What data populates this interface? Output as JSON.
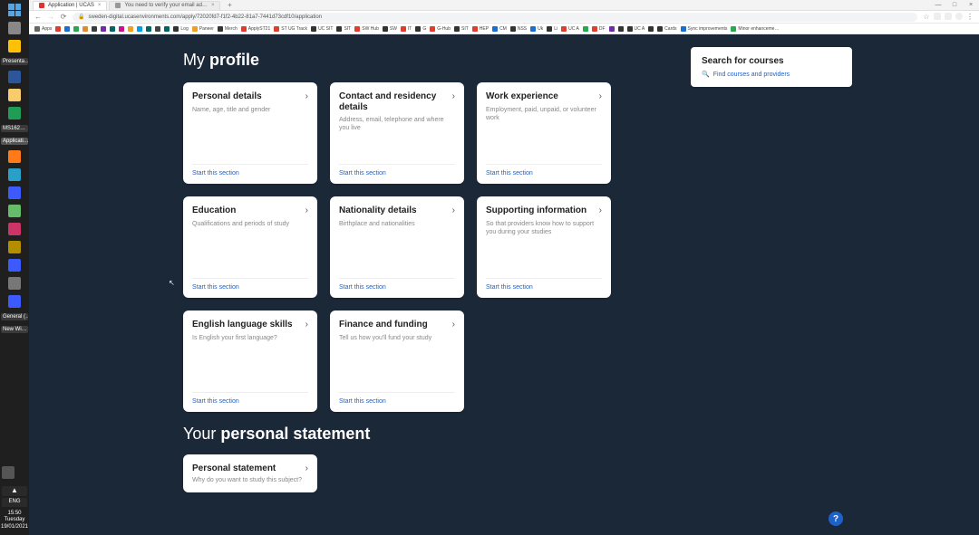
{
  "taskbar": {
    "labels": [
      "Presenta…",
      "MS162…",
      "Applicati…",
      "General (…",
      "New Wi…"
    ],
    "lang": "ENG",
    "time": "15:50",
    "day": "Tuesday",
    "date": "19/01/2021"
  },
  "tabs": {
    "active": "Application | UCAS",
    "second": "You need to verify your email ad…"
  },
  "url": "sweden-digital.ucasenvironments.com/apply/72020fd7-f1f2-4b22-81a7-7441d73cdf10/application",
  "bookmarks": [
    {
      "label": "Apps",
      "color": "#666"
    },
    {
      "label": "",
      "color": "#e03e2d"
    },
    {
      "label": "",
      "color": "#196fd0"
    },
    {
      "label": "",
      "color": "#2aa84f"
    },
    {
      "label": "",
      "color": "#e0892d"
    },
    {
      "label": "",
      "color": "#3b3b3b"
    },
    {
      "label": "",
      "color": "#6f2da8"
    },
    {
      "label": "",
      "color": "#006666"
    },
    {
      "label": "",
      "color": "#c71585"
    },
    {
      "label": "",
      "color": "#f0a020"
    },
    {
      "label": "",
      "color": "#00a0e9"
    },
    {
      "label": "",
      "color": "#006666"
    },
    {
      "label": "",
      "color": "#444"
    },
    {
      "label": "",
      "color": "#006666"
    },
    {
      "label": "Log",
      "color": "#333"
    },
    {
      "label": "Paneer",
      "color": "#f0a020"
    },
    {
      "label": "Merch",
      "color": "#333"
    },
    {
      "label": "ApplyST21",
      "color": "#e03e2d"
    },
    {
      "label": "ST UG Track",
      "color": "#e03e2d"
    },
    {
      "label": "UC SIT",
      "color": "#333"
    },
    {
      "label": "SIT",
      "color": "#333"
    },
    {
      "label": "SW Hub",
      "color": "#e03e2d"
    },
    {
      "label": "SW",
      "color": "#333"
    },
    {
      "label": "IT",
      "color": "#e03e2d"
    },
    {
      "label": "G",
      "color": "#333"
    },
    {
      "label": "G-Hub",
      "color": "#e03e2d"
    },
    {
      "label": "SIT",
      "color": "#333"
    },
    {
      "label": "HEP",
      "color": "#e03e2d"
    },
    {
      "label": "CM",
      "color": "#196fd0"
    },
    {
      "label": "NSS",
      "color": "#333"
    },
    {
      "label": "Uk",
      "color": "#196fd0"
    },
    {
      "label": "Li",
      "color": "#333"
    },
    {
      "label": "UC A",
      "color": "#e03e2d"
    },
    {
      "label": "",
      "color": "#2aa84f"
    },
    {
      "label": "DF",
      "color": "#e03e2d"
    },
    {
      "label": "",
      "color": "#6f2da8"
    },
    {
      "label": "",
      "color": "#333"
    },
    {
      "label": "UC A",
      "color": "#333"
    },
    {
      "label": "",
      "color": "#333"
    },
    {
      "label": "Cards",
      "color": "#333"
    },
    {
      "label": "Sync improvements",
      "color": "#196fd0"
    },
    {
      "label": "Minor enhanceme…",
      "color": "#2aa84f"
    }
  ],
  "page": {
    "profile_heading_prefix": "My ",
    "profile_heading_bold": "profile",
    "statement_heading_prefix": "Your ",
    "statement_heading_bold": "personal statement",
    "start_link": "Start this section"
  },
  "cards": {
    "r1": [
      {
        "title": "Personal details",
        "desc": "Name, age, title and gender"
      },
      {
        "title": "Contact and residency details",
        "desc": "Address, email, telephone and where you live"
      },
      {
        "title": "Work experience",
        "desc": "Employment, paid, unpaid, or volunteer work"
      }
    ],
    "r2": [
      {
        "title": "Education",
        "desc": "Qualifications and periods of study"
      },
      {
        "title": "Nationality details",
        "desc": "Birthplace and nationalities"
      },
      {
        "title": "Supporting information",
        "desc": "So that providers know how to support you during your studies"
      }
    ],
    "r3": [
      {
        "title": "English language skills",
        "desc": "Is English your first language?"
      },
      {
        "title": "Finance and funding",
        "desc": "Tell us how you'll fund your study"
      }
    ],
    "statement": {
      "title": "Personal statement",
      "desc": "Why do you want to study this subject?"
    }
  },
  "search": {
    "title": "Search for courses",
    "link": "Find courses and providers"
  }
}
